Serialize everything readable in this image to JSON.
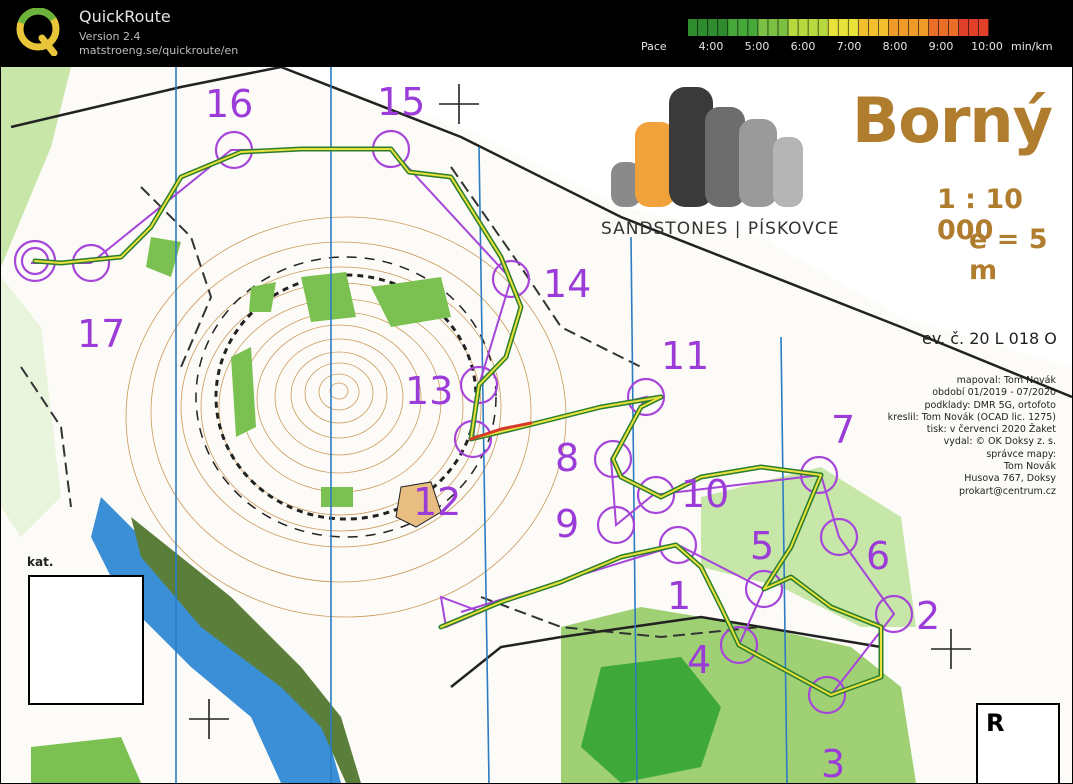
{
  "app": {
    "title": "QuickRoute",
    "version": "Version 2.4",
    "url": "matstroeng.se/quickroute/en"
  },
  "pace_legend": {
    "label": "Pace",
    "ticks": [
      "4:00",
      "5:00",
      "6:00",
      "7:00",
      "8:00",
      "9:00",
      "10:00"
    ],
    "unit": "min/km",
    "colors": [
      "#2e8b2e",
      "#47a83a",
      "#7cc043",
      "#b8d83f",
      "#e8e23a",
      "#f2c02e",
      "#f09a2a",
      "#ea6d28",
      "#e0402a"
    ]
  },
  "map": {
    "title": "Borný",
    "scale": "1 : 10 000",
    "equidistance": "e = 5 m",
    "sponsor": "SANDSTONES | PÍSKOVCE",
    "map_id": "ev. č. 20 L 018 O",
    "credits": [
      "mapoval: Tom Novák",
      "období 01/2019 - 07/2020",
      "podklady: DMR 5G, ortofoto",
      "kreslil: Tom Novák (OCAD lic. 1275)",
      "tisk: v červenci 2020 Žaket",
      "vydal: © OK Doksy z. s.",
      "správce mapy:",
      "Tom Novák",
      "Husova 767, Doksy",
      "prokart@centrum.cz"
    ],
    "kat_label": "kat.",
    "r_label": "R",
    "controls": [
      "1",
      "2",
      "3",
      "4",
      "5",
      "6",
      "7",
      "8",
      "9",
      "10",
      "11",
      "12",
      "13",
      "14",
      "15",
      "16",
      "17"
    ],
    "colors": {
      "course": "#a645d9",
      "brown": "#b07d2e",
      "water": "#3a8fd6"
    }
  }
}
